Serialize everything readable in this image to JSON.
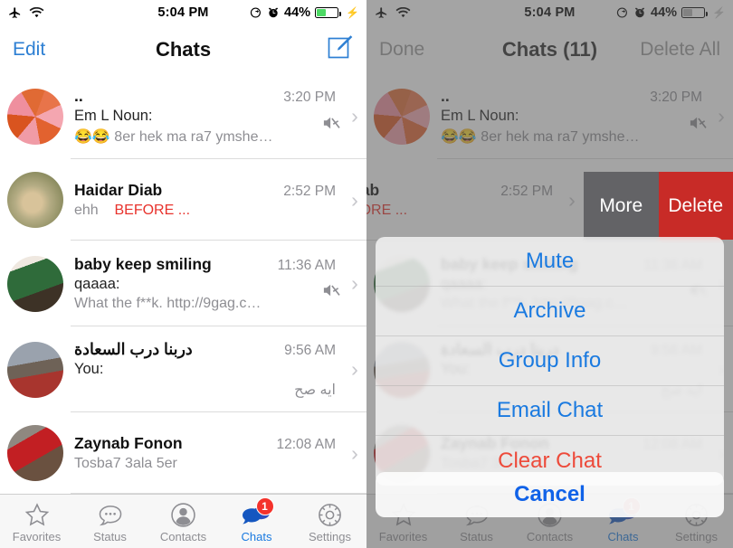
{
  "status_bar": {
    "airplane_icon": "airplane-mode-icon",
    "wifi_icon": "wifi-icon",
    "time": "5:04 PM",
    "rotation_lock_icon": "rotation-lock-icon",
    "alarm_icon": "alarm-clock-icon",
    "battery_percent": "44%",
    "battery_level": 44,
    "battery_color": "#4cd964",
    "charging_icon": "charging-bolt-icon"
  },
  "left_panel": {
    "nav": {
      "left_button": "Edit",
      "title": "Chats",
      "right_icon": "compose-new-chat-icon"
    },
    "accent_color": "#2d7fd3"
  },
  "right_panel": {
    "nav": {
      "left_button": "Done",
      "title": "Chats (11)",
      "right_button": "Delete All"
    },
    "swipe_actions": [
      {
        "label": "More",
        "color": "#636366"
      },
      {
        "label": "Delete",
        "color": "#c82b27"
      }
    ],
    "action_sheet": {
      "items": [
        {
          "label": "Mute",
          "style": "default"
        },
        {
          "label": "Archive",
          "style": "default"
        },
        {
          "label": "Group Info",
          "style": "default"
        },
        {
          "label": "Email Chat",
          "style": "default"
        },
        {
          "label": "Clear Chat",
          "style": "destructive"
        }
      ],
      "cancel_label": "Cancel"
    }
  },
  "chats": [
    {
      "name": "..",
      "time": "3:20 PM",
      "sender": "Em L Noun:",
      "preview": "😂😂 8er hek ma ra7 ymshe…",
      "muted": true,
      "avatar": "avatar-pink-orange-collage"
    },
    {
      "name": "Haidar  Diab",
      "time": "2:52 PM",
      "sender": "",
      "preview_plain": "ehh",
      "preview_red": "BEFORE ...",
      "muted": false,
      "avatar": "avatar-soldier-helmet"
    },
    {
      "name": "baby keep smiling",
      "time": "11:36 AM",
      "sender": "qaaaa:",
      "preview": "What the f**k. http://9gag.c…",
      "muted": true,
      "avatar": "avatar-green-suit-person"
    },
    {
      "name": "دربنا درب السعادة",
      "time": "9:56 AM",
      "sender": "You:",
      "preview": "ايه صح",
      "muted": false,
      "rtl": true,
      "avatar": "avatar-man-red-jacket"
    },
    {
      "name": "Zaynab Fonon",
      "time": "12:08 AM",
      "sender": "",
      "preview": "Tosba7 3ala 5er",
      "muted": false,
      "avatar": "avatar-woman-red-scarf"
    }
  ],
  "tab_bar": {
    "tabs": [
      {
        "label": "Favorites",
        "icon": "star-icon",
        "active": false,
        "badge": ""
      },
      {
        "label": "Status",
        "icon": "speech-bubble-dots-icon",
        "active": false,
        "badge": ""
      },
      {
        "label": "Contacts",
        "icon": "person-circle-icon",
        "active": false,
        "badge": ""
      },
      {
        "label": "Chats",
        "icon": "two-chat-bubbles-icon",
        "active": true,
        "badge": "1"
      },
      {
        "label": "Settings",
        "icon": "gear-icon",
        "active": false,
        "badge": ""
      }
    ],
    "active_color": "#1a7ae0",
    "badge_color": "#f4322b"
  }
}
